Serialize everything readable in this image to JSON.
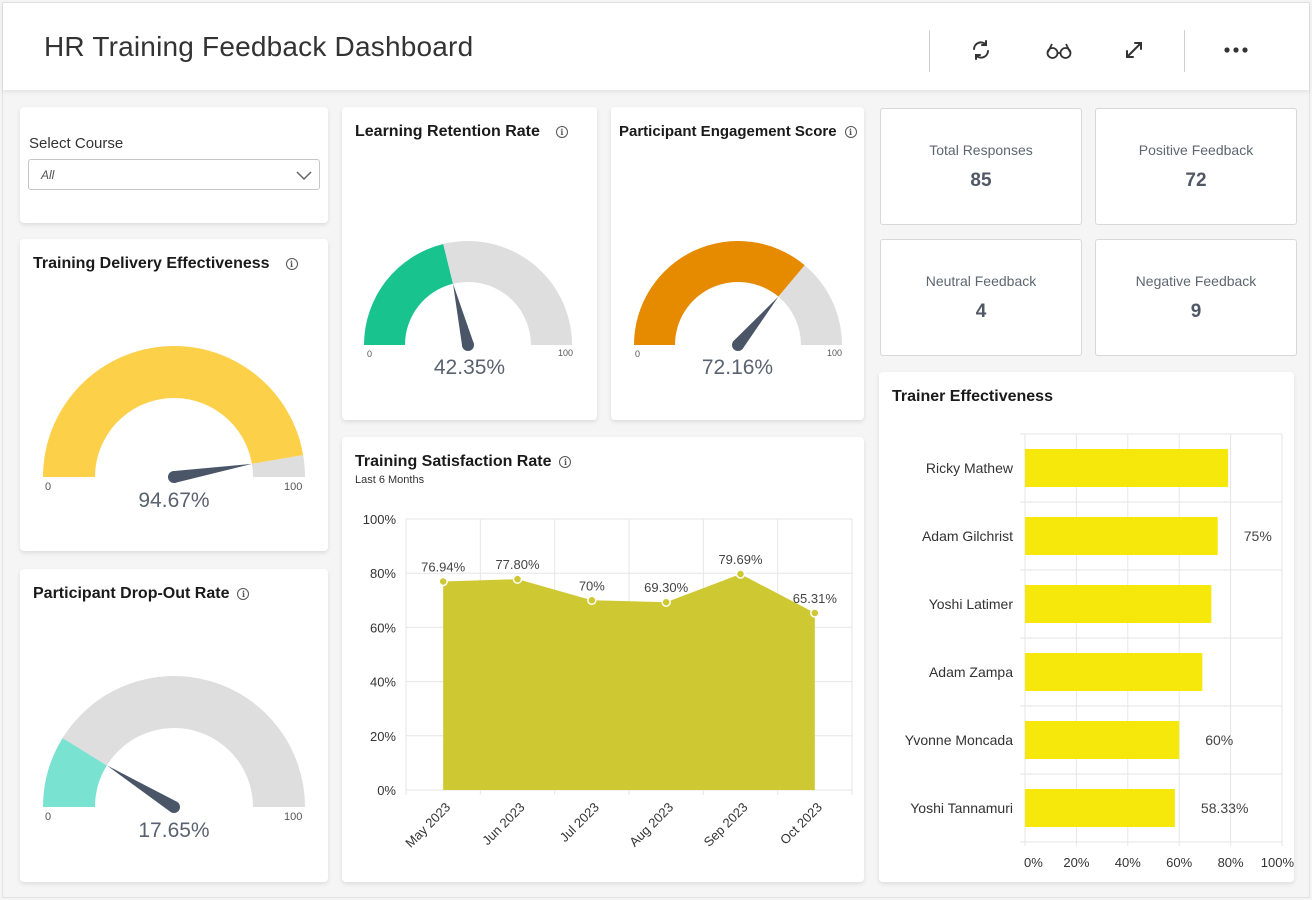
{
  "header": {
    "title": "HR Training Feedback Dashboard",
    "actions": [
      {
        "name": "refresh-icon",
        "label": "Refresh"
      },
      {
        "name": "glasses-icon",
        "label": "View"
      },
      {
        "name": "expand-icon",
        "label": "Fullscreen"
      },
      {
        "name": "more-icon",
        "label": "More"
      }
    ]
  },
  "filter": {
    "label": "Select Course",
    "selected": "All"
  },
  "gauges": {
    "delivery": {
      "title": "Training Delivery Effectiveness",
      "value": 94.67,
      "display": "94.67%",
      "min": "0",
      "max": "100",
      "color": "#FDD04A"
    },
    "dropout": {
      "title": "Participant Drop-Out Rate",
      "value": 17.65,
      "display": "17.65%",
      "min": "0",
      "max": "100",
      "color": "#7AE2D0"
    },
    "retention": {
      "title": "Learning Retention Rate",
      "value": 42.35,
      "display": "42.35%",
      "min": "0",
      "max": "100",
      "color": "#18C38E"
    },
    "engagement": {
      "title": "Participant Engagement Score",
      "value": 72.16,
      "display": "72.16%",
      "min": "0",
      "max": "100",
      "color": "#E68A00"
    }
  },
  "kpis": [
    {
      "label": "Total Responses",
      "value": "85"
    },
    {
      "label": "Positive Feedback",
      "value": "72"
    },
    {
      "label": "Neutral Feedback",
      "value": "4"
    },
    {
      "label": "Negative Feedback",
      "value": "9"
    }
  ],
  "colors": {
    "gauge_track": "#DEDEDE",
    "needle": "#4A5568",
    "area_fill": "#CEC832",
    "bar_fill": "#F5E80A"
  },
  "chart_data": [
    {
      "type": "area",
      "title": "Training Satisfaction Rate",
      "subtitle": "Last 6 Months",
      "categories": [
        "May 2023",
        "Jun 2023",
        "Jul 2023",
        "Aug 2023",
        "Sep 2023",
        "Oct 2023"
      ],
      "values": [
        76.94,
        77.8,
        70,
        69.3,
        79.69,
        65.31
      ],
      "data_labels": [
        "76.94%",
        "77.80%",
        "70%",
        "69.30%",
        "79.69%",
        "65.31%"
      ],
      "ylim": [
        0,
        100
      ],
      "yticks": [
        "0%",
        "20%",
        "40%",
        "60%",
        "80%",
        "100%"
      ],
      "grid": true,
      "xlabel": "",
      "ylabel": ""
    },
    {
      "type": "bar",
      "orientation": "horizontal",
      "title": "Trainer Effectiveness",
      "categories": [
        "Ricky Mathew",
        "Adam Gilchrist",
        "Yoshi Latimer",
        "Adam Zampa",
        "Yvonne Moncada",
        "Yoshi Tannamuri"
      ],
      "values": [
        79,
        75,
        72.5,
        69,
        60,
        58.33
      ],
      "data_labels": [
        "",
        "75%",
        "",
        "",
        "60%",
        "58.33%"
      ],
      "xlim": [
        0,
        100
      ],
      "xticks": [
        "0%",
        "20%",
        "40%",
        "60%",
        "80%",
        "100%"
      ],
      "grid": true,
      "xlabel": "",
      "ylabel": ""
    }
  ]
}
